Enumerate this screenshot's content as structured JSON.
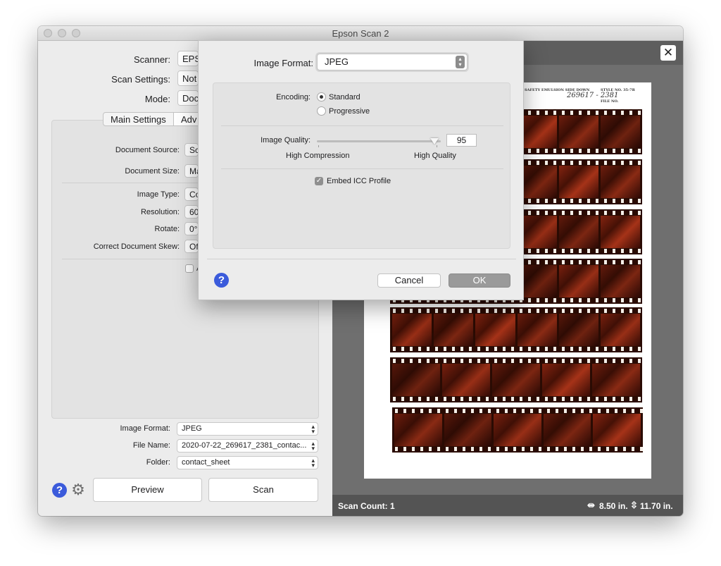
{
  "window": {
    "title": "Epson Scan 2"
  },
  "left": {
    "scanner_label": "Scanner:",
    "scanner_value": "EPS",
    "scan_settings_label": "Scan Settings:",
    "scan_settings_value": "Not",
    "mode_label": "Mode:",
    "mode_value": "Doc",
    "tabs": {
      "main": "Main Settings",
      "advanced": "Adv"
    },
    "document_source_label": "Document Source:",
    "document_source_value": "Sc",
    "document_size_label": "Document Size:",
    "document_size_value": "Ma",
    "image_type_label": "Image Type:",
    "image_type_value": "Co",
    "resolution_label": "Resolution:",
    "resolution_value": "60",
    "rotate_label": "Rotate:",
    "rotate_value": "0°",
    "skew_label": "Correct Document Skew:",
    "skew_value": "Of",
    "checkbox_label": "A",
    "image_format_label": "Image Format:",
    "image_format_value": "JPEG",
    "file_name_label": "File Name:",
    "file_name_value": "2020-07-22_269617_2381_contac...",
    "folder_label": "Folder:",
    "folder_value": "contact_sheet",
    "preview_button": "Preview",
    "scan_button": "Scan",
    "help_glyph": "?"
  },
  "preview": {
    "close_glyph": "✕",
    "scan_count": "Scan Count: 1",
    "width": "8.50 in.",
    "height": "11.70 in.",
    "paper_header": "SAFETY EMULSION SIDE DOWN",
    "paper_style": "STYLE NO. 35-7R",
    "paper_file": "FILE NO.",
    "handwritten": "269617 - 2381",
    "strip_frames": [
      6,
      6,
      6,
      6,
      6,
      5,
      5
    ]
  },
  "dialog": {
    "image_format_label": "Image Format:",
    "image_format_value": "JPEG",
    "encoding_label": "Encoding:",
    "encoding_standard": "Standard",
    "encoding_progressive": "Progressive",
    "image_quality_label": "Image Quality:",
    "image_quality_value": "95",
    "image_quality_fraction": 0.95,
    "high_compression": "High Compression",
    "high_quality": "High Quality",
    "embed_icc": "Embed ICC Profile",
    "cancel": "Cancel",
    "ok": "OK",
    "help_glyph": "?"
  },
  "colors": {
    "help_blue": "#3b5bdb",
    "film_base": "#2a0b03",
    "ok_button": "#9a9a9a"
  }
}
